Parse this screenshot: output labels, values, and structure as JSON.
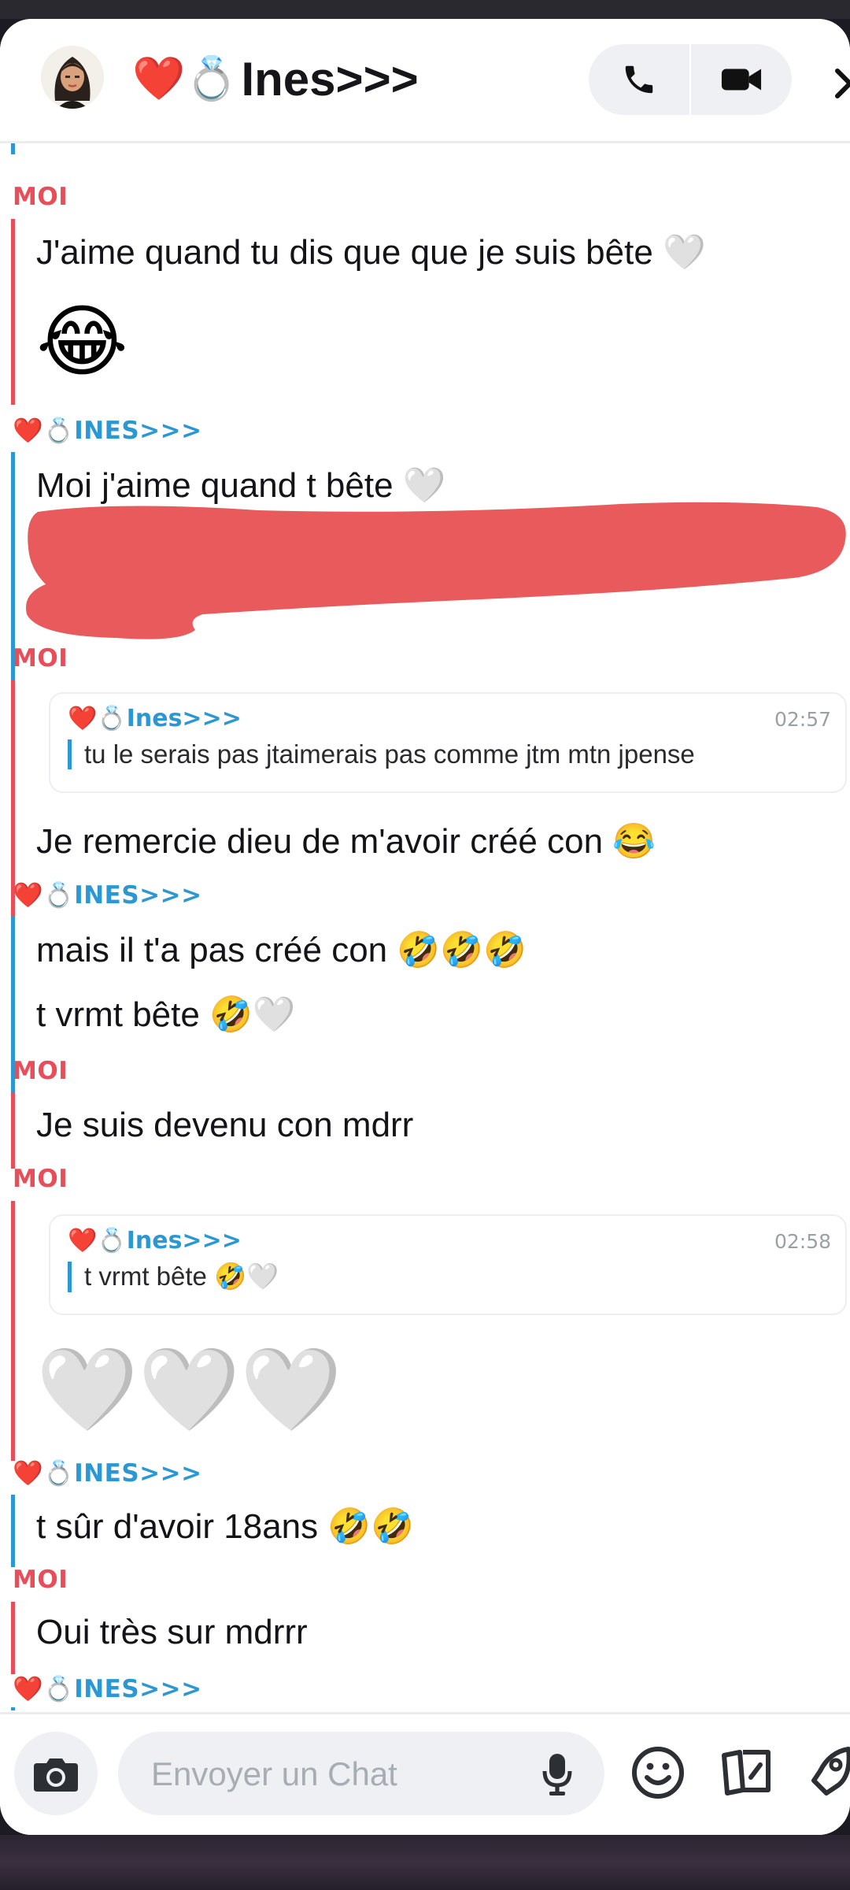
{
  "header": {
    "title_emoji": "❤️💍",
    "title": "Ines>>>",
    "call_icon": "phone-icon",
    "video_icon": "video-camera-icon",
    "more_icon": "chevron-right-icon"
  },
  "labels": {
    "me": "MOI",
    "other": "INES>>>",
    "other_emoji": "❤️💍"
  },
  "messages": {
    "m1_text": "J'aime quand tu dis que que je suis bête 🤍",
    "m1_emoji": "😂",
    "m2_text": "Moi j'aime quand t bête 🤍",
    "m3_quote_name": "❤️💍Ines>>>",
    "m3_quote_time": "02:57",
    "m3_quote_text": "tu le serais pas jtaimerais pas comme jtm mtn jpense",
    "m3_text": "Je remercie dieu de m'avoir créé con 😂",
    "m4_text_a": "mais il t'a pas créé con 🤣🤣🤣",
    "m4_text_b": "t vrmt bête 🤣🤍",
    "m5_text": "Je suis devenu con mdrr",
    "m6_quote_name": "❤️💍Ines>>>",
    "m6_quote_time": "02:58",
    "m6_quote_text": "t vrmt bête 🤣🤍",
    "m6_emoji": "🤍🤍🤍",
    "m7_text": "t sûr d'avoir 18ans 🤣🤣",
    "m8_text": "Oui très sur mdrrr"
  },
  "input": {
    "placeholder": "Envoyer un Chat",
    "camera_icon": "camera-icon",
    "mic_icon": "microphone-icon",
    "emoji_icon": "smiley-icon",
    "cards_icon": "cards-icon",
    "rocket_icon": "rocket-icon"
  },
  "colors": {
    "me": "#e84d5a",
    "other": "#2b98d3",
    "redaction": "#e85a5c"
  }
}
